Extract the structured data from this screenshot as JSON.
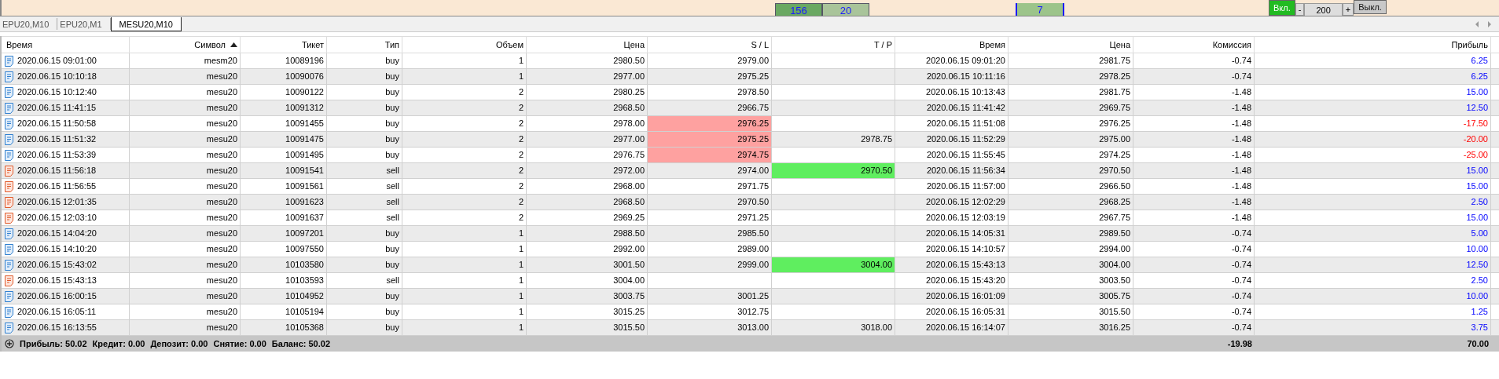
{
  "top_panel": {
    "cells": [
      "156",
      "20",
      "7"
    ],
    "controls": [
      {
        "label": "Вкл.",
        "kind": "toggle",
        "on": true
      },
      {
        "label": "-",
        "kind": "step"
      },
      {
        "label": "200",
        "kind": "value"
      },
      {
        "label": "+",
        "kind": "step"
      },
      {
        "label": "Выкл.",
        "kind": "toggle",
        "on": false
      }
    ]
  },
  "tabs": [
    {
      "label": "EPU20,M10",
      "selected": false
    },
    {
      "label": "EPU20,M1",
      "selected": false
    },
    {
      "label": "MESU20,M10",
      "selected": true
    }
  ],
  "table": {
    "columns": [
      {
        "label": "Время",
        "sorted": false
      },
      {
        "label": "Символ",
        "sorted": true
      },
      {
        "label": "Тикет",
        "sorted": false
      },
      {
        "label": "Тип",
        "sorted": false
      },
      {
        "label": "Объем",
        "sorted": false
      },
      {
        "label": "Цена",
        "sorted": false
      },
      {
        "label": "S / L",
        "sorted": false
      },
      {
        "label": "T / P",
        "sorted": false
      },
      {
        "label": "Время",
        "sorted": false
      },
      {
        "label": "Цена",
        "sorted": false
      },
      {
        "label": "Комиссия",
        "sorted": false
      },
      {
        "label": "Прибыль",
        "sorted": false
      }
    ],
    "rows": [
      {
        "kind": "buy",
        "cells": [
          "2020.06.15 09:01:00",
          "mesm20",
          "10089196",
          "buy",
          "1",
          "2980.50",
          "2979.00",
          "",
          "2020.06.15 09:01:20",
          "2981.75",
          "-0.74",
          "6.25"
        ],
        "sl_hit": false,
        "tp_hit": false,
        "loss": false
      },
      {
        "kind": "buy",
        "cells": [
          "2020.06.15 10:10:18",
          "mesu20",
          "10090076",
          "buy",
          "1",
          "2977.00",
          "2975.25",
          "",
          "2020.06.15 10:11:16",
          "2978.25",
          "-0.74",
          "6.25"
        ],
        "sl_hit": false,
        "tp_hit": false,
        "loss": false
      },
      {
        "kind": "buy",
        "cells": [
          "2020.06.15 10:12:40",
          "mesu20",
          "10090122",
          "buy",
          "2",
          "2980.25",
          "2978.50",
          "",
          "2020.06.15 10:13:43",
          "2981.75",
          "-1.48",
          "15.00"
        ],
        "sl_hit": false,
        "tp_hit": false,
        "loss": false
      },
      {
        "kind": "buy",
        "cells": [
          "2020.06.15 11:41:15",
          "mesu20",
          "10091312",
          "buy",
          "2",
          "2968.50",
          "2966.75",
          "",
          "2020.06.15 11:41:42",
          "2969.75",
          "-1.48",
          "12.50"
        ],
        "sl_hit": false,
        "tp_hit": false,
        "loss": false
      },
      {
        "kind": "buy",
        "cells": [
          "2020.06.15 11:50:58",
          "mesu20",
          "10091455",
          "buy",
          "2",
          "2978.00",
          "2976.25",
          "",
          "2020.06.15 11:51:08",
          "2976.25",
          "-1.48",
          "-17.50"
        ],
        "sl_hit": true,
        "tp_hit": false,
        "loss": true
      },
      {
        "kind": "buy",
        "cells": [
          "2020.06.15 11:51:32",
          "mesu20",
          "10091475",
          "buy",
          "2",
          "2977.00",
          "2975.25",
          "2978.75",
          "2020.06.15 11:52:29",
          "2975.00",
          "-1.48",
          "-20.00"
        ],
        "sl_hit": true,
        "tp_hit": false,
        "loss": true
      },
      {
        "kind": "buy",
        "cells": [
          "2020.06.15 11:53:39",
          "mesu20",
          "10091495",
          "buy",
          "2",
          "2976.75",
          "2974.75",
          "",
          "2020.06.15 11:55:45",
          "2974.25",
          "-1.48",
          "-25.00"
        ],
        "sl_hit": true,
        "tp_hit": false,
        "loss": true
      },
      {
        "kind": "sell",
        "cells": [
          "2020.06.15 11:56:18",
          "mesu20",
          "10091541",
          "sell",
          "2",
          "2972.00",
          "2974.00",
          "2970.50",
          "2020.06.15 11:56:34",
          "2970.50",
          "-1.48",
          "15.00"
        ],
        "sl_hit": false,
        "tp_hit": true,
        "loss": false
      },
      {
        "kind": "sell",
        "cells": [
          "2020.06.15 11:56:55",
          "mesu20",
          "10091561",
          "sell",
          "2",
          "2968.00",
          "2971.75",
          "",
          "2020.06.15 11:57:00",
          "2966.50",
          "-1.48",
          "15.00"
        ],
        "sl_hit": false,
        "tp_hit": false,
        "loss": false
      },
      {
        "kind": "sell",
        "cells": [
          "2020.06.15 12:01:35",
          "mesu20",
          "10091623",
          "sell",
          "2",
          "2968.50",
          "2970.50",
          "",
          "2020.06.15 12:02:29",
          "2968.25",
          "-1.48",
          "2.50"
        ],
        "sl_hit": false,
        "tp_hit": false,
        "loss": false
      },
      {
        "kind": "sell",
        "cells": [
          "2020.06.15 12:03:10",
          "mesu20",
          "10091637",
          "sell",
          "2",
          "2969.25",
          "2971.25",
          "",
          "2020.06.15 12:03:19",
          "2967.75",
          "-1.48",
          "15.00"
        ],
        "sl_hit": false,
        "tp_hit": false,
        "loss": false
      },
      {
        "kind": "buy",
        "cells": [
          "2020.06.15 14:04:20",
          "mesu20",
          "10097201",
          "buy",
          "1",
          "2988.50",
          "2985.50",
          "",
          "2020.06.15 14:05:31",
          "2989.50",
          "-0.74",
          "5.00"
        ],
        "sl_hit": false,
        "tp_hit": false,
        "loss": false
      },
      {
        "kind": "buy",
        "cells": [
          "2020.06.15 14:10:20",
          "mesu20",
          "10097550",
          "buy",
          "1",
          "2992.00",
          "2989.00",
          "",
          "2020.06.15 14:10:57",
          "2994.00",
          "-0.74",
          "10.00"
        ],
        "sl_hit": false,
        "tp_hit": false,
        "loss": false
      },
      {
        "kind": "buy",
        "cells": [
          "2020.06.15 15:43:02",
          "mesu20",
          "10103580",
          "buy",
          "1",
          "3001.50",
          "2999.00",
          "3004.00",
          "2020.06.15 15:43:13",
          "3004.00",
          "-0.74",
          "12.50"
        ],
        "sl_hit": false,
        "tp_hit": true,
        "loss": false
      },
      {
        "kind": "sell",
        "cells": [
          "2020.06.15 15:43:13",
          "mesu20",
          "10103593",
          "sell",
          "1",
          "3004.00",
          "",
          "",
          "2020.06.15 15:43:20",
          "3003.50",
          "-0.74",
          "2.50"
        ],
        "sl_hit": false,
        "tp_hit": false,
        "loss": false
      },
      {
        "kind": "buy",
        "cells": [
          "2020.06.15 16:00:15",
          "mesu20",
          "10104952",
          "buy",
          "1",
          "3003.75",
          "3001.25",
          "",
          "2020.06.15 16:01:09",
          "3005.75",
          "-0.74",
          "10.00"
        ],
        "sl_hit": false,
        "tp_hit": false,
        "loss": false
      },
      {
        "kind": "buy",
        "cells": [
          "2020.06.15 16:05:11",
          "mesu20",
          "10105194",
          "buy",
          "1",
          "3015.25",
          "3012.75",
          "",
          "2020.06.15 16:05:31",
          "3015.50",
          "-0.74",
          "1.25"
        ],
        "sl_hit": false,
        "tp_hit": false,
        "loss": false
      },
      {
        "kind": "buy",
        "cells": [
          "2020.06.15 16:13:55",
          "mesu20",
          "10105368",
          "buy",
          "1",
          "3015.50",
          "3013.00",
          "3018.00",
          "2020.06.15 16:14:07",
          "3016.25",
          "-0.74",
          "3.75"
        ],
        "sl_hit": false,
        "tp_hit": false,
        "loss": false
      }
    ]
  },
  "summary": {
    "items": [
      "Прибыль: 50.02",
      "Кредит: 0.00",
      "Депозит: 0.00",
      "Снятие: 0.00",
      "Баланс: 50.02"
    ],
    "commission_total": "-19.98",
    "profit_total": "70.00"
  }
}
